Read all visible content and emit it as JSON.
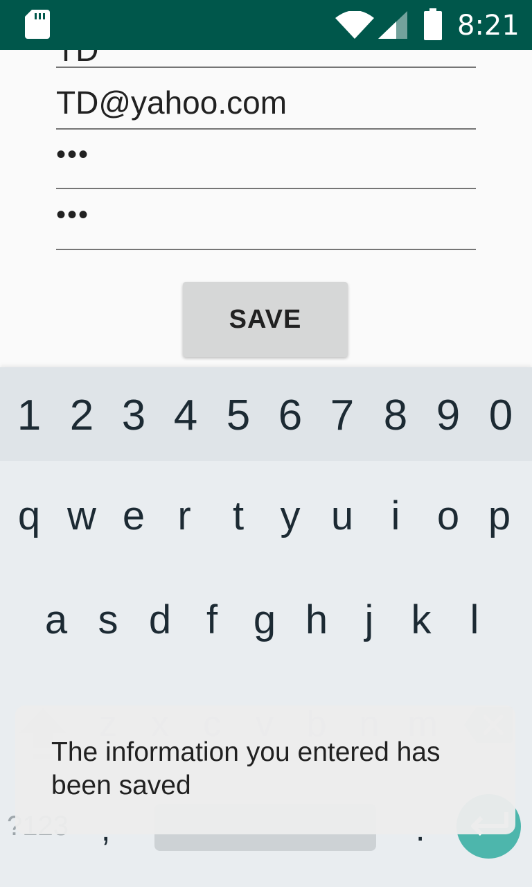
{
  "status_bar": {
    "time": "8:21",
    "icons": [
      "sd-card-icon",
      "wifi-icon",
      "signal-icon",
      "battery-icon"
    ]
  },
  "form": {
    "name_value": "TD",
    "email_value": "TD@yahoo.com",
    "password_value": "•••",
    "confirm_password_value": "•••",
    "save_label": "SAVE"
  },
  "keyboard": {
    "number_row": [
      "1",
      "2",
      "3",
      "4",
      "5",
      "6",
      "7",
      "8",
      "9",
      "0"
    ],
    "row_1": [
      "q",
      "w",
      "e",
      "r",
      "t",
      "y",
      "u",
      "i",
      "o",
      "p"
    ],
    "row_2": [
      "a",
      "s",
      "d",
      "f",
      "g",
      "h",
      "j",
      "k",
      "l"
    ],
    "row_3": [
      "z",
      "x",
      "c",
      "v",
      "b",
      "n",
      "m"
    ],
    "symbols_label": "?123",
    "comma": ",",
    "period": ".",
    "enter_color": "#4db6ac"
  },
  "toast": {
    "message": "The information you entered has been saved"
  },
  "colors": {
    "status_bar": "#00574b",
    "keyboard_bg": "#e9edf0"
  }
}
